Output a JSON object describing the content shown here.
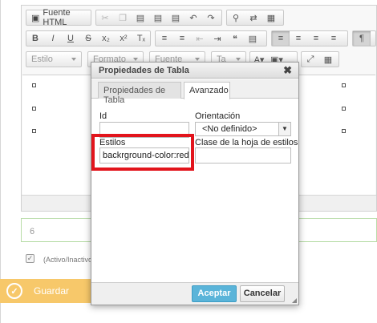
{
  "toolbar": {
    "source_label": "Fuente HTML",
    "icons_row1": [
      "source-icon",
      "cut-icon",
      "copy-icon",
      "paste-icon",
      "paste-text-icon",
      "paste-word-icon",
      "undo-icon",
      "redo-icon",
      "find-icon",
      "replace-icon",
      "select-all-icon"
    ],
    "format_buttons": [
      "B",
      "I",
      "U",
      "S",
      "x₂",
      "x²",
      "Tₓ"
    ],
    "style_combo": "Estilo",
    "format_combo": "Formato",
    "font_combo": "Fuente",
    "size_combo": "Ta"
  },
  "number_field": {
    "value": "6"
  },
  "checkbox": {
    "mark": "✓",
    "label": "(Activo/Inactivo)"
  },
  "save": {
    "label": "Guardar",
    "icon": "✓"
  },
  "dialog": {
    "title": "Propiedades de Tabla",
    "close": "✖",
    "tabs": [
      {
        "label": "Propiedades de Tabla",
        "active": false
      },
      {
        "label": "Avanzado",
        "active": true
      }
    ],
    "id_label": "Id",
    "id_value": "",
    "orientation_label": "Orientación",
    "orientation_value": "<No definido>",
    "styles_label": "Estilos",
    "styles_value": "backrground-color:red;w",
    "class_label": "Clase de la hoja de estilos",
    "class_value": "",
    "ok_label": "Aceptar",
    "cancel_label": "Cancelar"
  },
  "colors": {
    "accent": "#5ab4d9",
    "highlight": "#e2141c",
    "save": "#f7c86a",
    "field_border": "#b8dca8"
  }
}
